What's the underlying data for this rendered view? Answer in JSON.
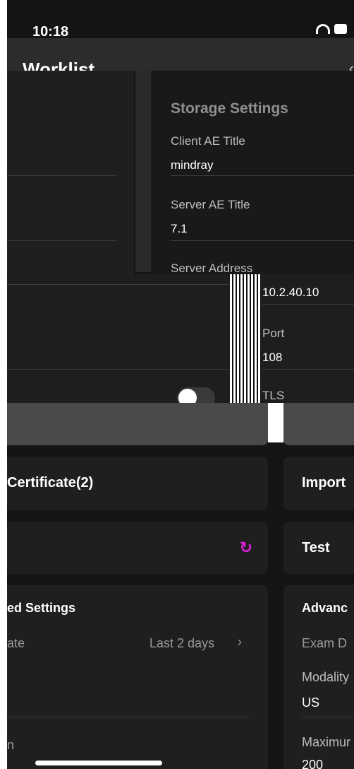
{
  "status_bar": {
    "time": "10:18"
  },
  "header": {
    "title": "Worklist",
    "back_chevron": "‹"
  },
  "storage_settings": {
    "title": "Storage Settings",
    "client_ae_title_label": "Client AE Title",
    "client_ae_title_value": "mindray",
    "server_ae_title_label": "Server AE Title",
    "server_ae_title_value": "7.1",
    "server_address_label": "Server Address",
    "server_address_value": "10.2.40.10",
    "port_label": "Port",
    "port_value": "108",
    "tls_label": "TLS"
  },
  "buttons": {
    "certificate": "Certificate(2)",
    "import": "Import",
    "test": "Test",
    "refresh_icon": "refresh-icon"
  },
  "left_advanced": {
    "title": "ed Settings",
    "row1_label": "ate",
    "row1_value": "Last 2 days",
    "row1_chevron": "›",
    "row3_label": "n"
  },
  "right_advanced": {
    "title": "Advanc",
    "exam_label": "Exam D",
    "modality_label": "Modality",
    "modality_value": "US",
    "maximum_label": "Maximur",
    "maximum_value": "200"
  },
  "colors": {
    "accent": "#e020e0",
    "background": "#141414",
    "card": "#1f1f1f"
  }
}
